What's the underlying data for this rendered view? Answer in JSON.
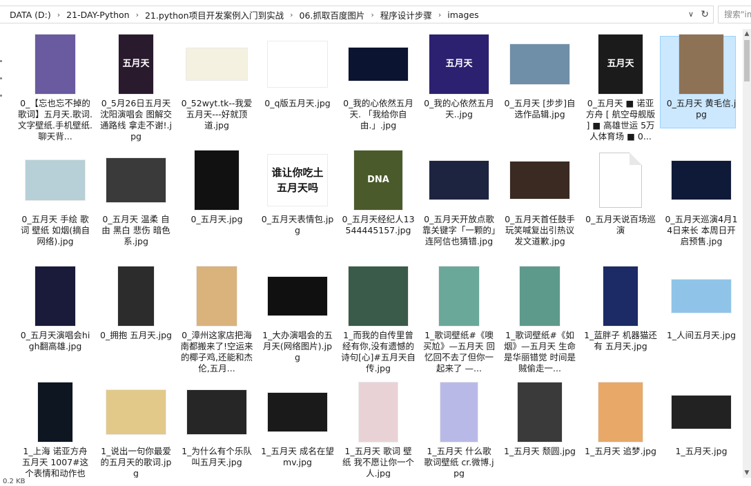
{
  "address": {
    "crumbs": [
      "DATA (D:)",
      "21-DAY-Python",
      "21.python项目开发案例入门到实战",
      "06.抓取百度图片",
      "程序设计步骤",
      "images"
    ],
    "dropdown_glyph": "∨",
    "refresh_glyph": "↻",
    "search_placeholder": "搜索\"im"
  },
  "status": {
    "text": "0.2 KB"
  },
  "files": [
    {
      "name": "0_【忘也忘不掉的歌词】五月天.歌词.文字壁纸.手机壁纸.聊天背...",
      "thumb_bg": "#6a5aa0",
      "thumb_text": "",
      "w": 58,
      "h": 86,
      "selected": false
    },
    {
      "name": "0_5月26日五月天沈阳演唱会 图解交通路线 拿走不谢!.jpg",
      "thumb_bg": "#2a1a2e",
      "thumb_text": "五月天",
      "w": 50,
      "h": 86,
      "selected": false
    },
    {
      "name": "0_52wyt.tk--我爱五月天---好就顶 道.jpg",
      "thumb_bg": "#f4f1e0",
      "thumb_text": "",
      "w": 88,
      "h": 46,
      "selected": false
    },
    {
      "name": "0_q版五月天.jpg",
      "thumb_bg": "#ffffff",
      "thumb_text": "",
      "w": 86,
      "h": 66,
      "selected": false
    },
    {
      "name": "0_我的心依然五月天. 「我给你自由.」.jpg",
      "thumb_bg": "#0b1430",
      "thumb_text": "",
      "w": 86,
      "h": 48,
      "selected": false
    },
    {
      "name": "0_我的心依然五月天..jpg",
      "thumb_bg": "#2b2170",
      "thumb_text": "五月天",
      "w": 86,
      "h": 86,
      "selected": false
    },
    {
      "name": "0_五月天 [步步]自选作品辑.jpg",
      "thumb_bg": "#6f8fa8",
      "thumb_text": "",
      "w": 86,
      "h": 58,
      "selected": false
    },
    {
      "name": "0_五月天 ■ 诺亚方舟 [ 航空母舰版 ] ■ 高雄世运 5万人体育场 ■ 0...",
      "thumb_bg": "#1b1b1b",
      "thumb_text": "五月天",
      "w": 64,
      "h": 86,
      "selected": false
    },
    {
      "name": "0_五月天 黄毛信.jpg",
      "thumb_bg": "#8e7256",
      "thumb_text": "",
      "w": 64,
      "h": 86,
      "selected": true
    },
    {
      "name": "0_五月天 手绘 歌词 壁纸 如烟(摘自网络).jpg",
      "thumb_bg": "#b7cfd6",
      "thumb_text": "",
      "w": 86,
      "h": 58,
      "selected": false
    },
    {
      "name": "0_五月天 温柔 自由 黑白 悲伤 暗色系.jpg",
      "thumb_bg": "#3a3a3a",
      "thumb_text": "",
      "w": 86,
      "h": 64,
      "selected": false
    },
    {
      "name": "0_五月天.jpg",
      "thumb_bg": "#111111",
      "thumb_text": "",
      "w": 64,
      "h": 86,
      "selected": false
    },
    {
      "name": "0_五月天表情包.jpg",
      "thumb_bg": "#ffffff",
      "thumb_text": "谁让你吃土 五月天吗",
      "w": 86,
      "h": 74,
      "selected": false
    },
    {
      "name": "0_五月天经纪人13544445157.jpg",
      "thumb_bg": "#4a5a2a",
      "thumb_text": "DNA",
      "w": 70,
      "h": 86,
      "selected": false
    },
    {
      "name": "0_五月天开放点歌靠关键字「一颗的」连阿信也猜错.jpg",
      "thumb_bg": "#1c2440",
      "thumb_text": "",
      "w": 86,
      "h": 56,
      "selected": false
    },
    {
      "name": "0_五月天首任鼓手玩笑喊复出引热议 发文道歉.jpg",
      "thumb_bg": "#3a2a22",
      "thumb_text": "",
      "w": 86,
      "h": 54,
      "selected": false
    },
    {
      "name": "0_五月天说百场巡演",
      "thumb_bg": "",
      "thumb_text": "",
      "w": 62,
      "h": 80,
      "selected": false
    },
    {
      "name": "0_五月天巡演4月14日来长 本周日开启预售.jpg",
      "thumb_bg": "#0f1a38",
      "thumb_text": "",
      "w": 86,
      "h": 56,
      "selected": false
    },
    {
      "name": "0_五月天演唱会high翻高雄.jpg",
      "thumb_bg": "#1a1a3a",
      "thumb_text": "",
      "w": 58,
      "h": 86,
      "selected": false
    },
    {
      "name": "0_拥抱 五月天.jpg",
      "thumb_bg": "#2c2c2c",
      "thumb_text": "",
      "w": 52,
      "h": 86,
      "selected": false
    },
    {
      "name": "0_漳州这家店把海南都搬来了!空运来的椰子鸡,还能和杰伦,五月...",
      "thumb_bg": "#d9b27c",
      "thumb_text": "",
      "w": 58,
      "h": 86,
      "selected": false
    },
    {
      "name": "1_大办演唱会的五月天(网络图片).jpg",
      "thumb_bg": "#101010",
      "thumb_text": "",
      "w": 86,
      "h": 56,
      "selected": false
    },
    {
      "name": "1_而我的自传里曾经有你,没有遗憾的诗句[心]#五月天自传.jpg",
      "thumb_bg": "#3a5a4a",
      "thumb_text": "",
      "w": 86,
      "h": 86,
      "selected": false
    },
    {
      "name": "1_歌词壁纸#《噢买尬》—五月天 回忆回不去了但你一起来了 —...",
      "thumb_bg": "#6aa89a",
      "thumb_text": "",
      "w": 58,
      "h": 86,
      "selected": false
    },
    {
      "name": "1_歌词壁纸#《如烟》—五月天 生命是华丽错觉 时间是贼偷走一...",
      "thumb_bg": "#5e9a8c",
      "thumb_text": "",
      "w": 58,
      "h": 86,
      "selected": false
    },
    {
      "name": "1_蓝胖子 机器猫还有 五月天.jpg",
      "thumb_bg": "#1c2a66",
      "thumb_text": "",
      "w": 50,
      "h": 86,
      "selected": false
    },
    {
      "name": "1_人间五月天.jpg",
      "thumb_bg": "#8fc4e8",
      "thumb_text": "",
      "w": 86,
      "h": 48,
      "selected": false
    },
    {
      "name": "1_上海 诺亚方舟 五月天 1007#这个表情和动作也",
      "thumb_bg": "#0e1622",
      "thumb_text": "",
      "w": 50,
      "h": 86,
      "selected": false
    },
    {
      "name": "1_说出一句你最爱的五月天的歌词.jpg",
      "thumb_bg": "#e2c98a",
      "thumb_text": "",
      "w": 86,
      "h": 64,
      "selected": false
    },
    {
      "name": "1_为什么有个乐队叫五月天.jpg",
      "thumb_bg": "#262626",
      "thumb_text": "",
      "w": 86,
      "h": 64,
      "selected": false
    },
    {
      "name": "1_五月天 成名在望mv.jpg",
      "thumb_bg": "#1a1a1a",
      "thumb_text": "",
      "w": 86,
      "h": 56,
      "selected": false
    },
    {
      "name": "1_五月天 歌词 壁纸 我不愿让你一个人.jpg",
      "thumb_bg": "#e9d2d6",
      "thumb_text": "",
      "w": 56,
      "h": 86,
      "selected": false
    },
    {
      "name": "1_五月天 什么歌 歌词壁纸 cr.微博.jpg",
      "thumb_bg": "#b9b9e8",
      "thumb_text": "",
      "w": 54,
      "h": 86,
      "selected": false
    },
    {
      "name": "1_五月天 颓圆.jpg",
      "thumb_bg": "#3a3a3a",
      "thumb_text": "",
      "w": 64,
      "h": 86,
      "selected": false
    },
    {
      "name": "1_五月天 追梦.jpg",
      "thumb_bg": "#e8a868",
      "thumb_text": "",
      "w": 64,
      "h": 86,
      "selected": false
    },
    {
      "name": "1_五月天.jpg",
      "thumb_bg": "#222222",
      "thumb_text": "",
      "w": 86,
      "h": 48,
      "selected": false
    }
  ]
}
